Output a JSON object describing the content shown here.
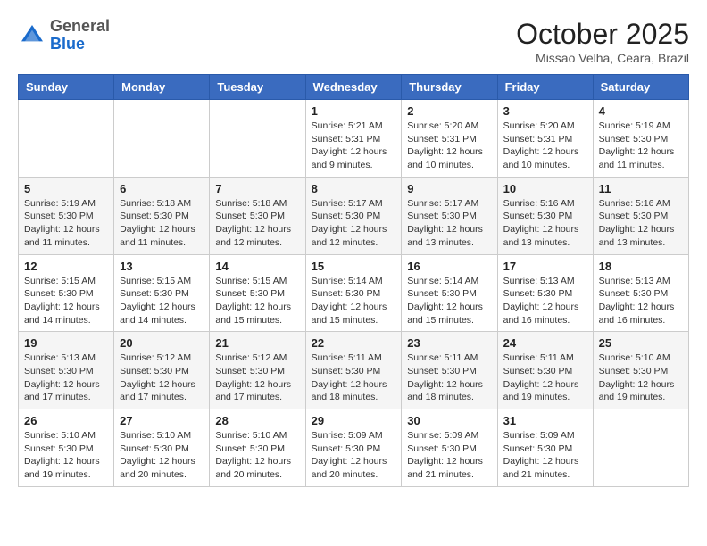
{
  "header": {
    "logo_general": "General",
    "logo_blue": "Blue",
    "month": "October 2025",
    "location": "Missao Velha, Ceara, Brazil"
  },
  "days_of_week": [
    "Sunday",
    "Monday",
    "Tuesday",
    "Wednesday",
    "Thursday",
    "Friday",
    "Saturday"
  ],
  "weeks": [
    [
      {
        "day": "",
        "info": ""
      },
      {
        "day": "",
        "info": ""
      },
      {
        "day": "",
        "info": ""
      },
      {
        "day": "1",
        "info": "Sunrise: 5:21 AM\nSunset: 5:31 PM\nDaylight: 12 hours\nand 9 minutes."
      },
      {
        "day": "2",
        "info": "Sunrise: 5:20 AM\nSunset: 5:31 PM\nDaylight: 12 hours\nand 10 minutes."
      },
      {
        "day": "3",
        "info": "Sunrise: 5:20 AM\nSunset: 5:31 PM\nDaylight: 12 hours\nand 10 minutes."
      },
      {
        "day": "4",
        "info": "Sunrise: 5:19 AM\nSunset: 5:30 PM\nDaylight: 12 hours\nand 11 minutes."
      }
    ],
    [
      {
        "day": "5",
        "info": "Sunrise: 5:19 AM\nSunset: 5:30 PM\nDaylight: 12 hours\nand 11 minutes."
      },
      {
        "day": "6",
        "info": "Sunrise: 5:18 AM\nSunset: 5:30 PM\nDaylight: 12 hours\nand 11 minutes."
      },
      {
        "day": "7",
        "info": "Sunrise: 5:18 AM\nSunset: 5:30 PM\nDaylight: 12 hours\nand 12 minutes."
      },
      {
        "day": "8",
        "info": "Sunrise: 5:17 AM\nSunset: 5:30 PM\nDaylight: 12 hours\nand 12 minutes."
      },
      {
        "day": "9",
        "info": "Sunrise: 5:17 AM\nSunset: 5:30 PM\nDaylight: 12 hours\nand 13 minutes."
      },
      {
        "day": "10",
        "info": "Sunrise: 5:16 AM\nSunset: 5:30 PM\nDaylight: 12 hours\nand 13 minutes."
      },
      {
        "day": "11",
        "info": "Sunrise: 5:16 AM\nSunset: 5:30 PM\nDaylight: 12 hours\nand 13 minutes."
      }
    ],
    [
      {
        "day": "12",
        "info": "Sunrise: 5:15 AM\nSunset: 5:30 PM\nDaylight: 12 hours\nand 14 minutes."
      },
      {
        "day": "13",
        "info": "Sunrise: 5:15 AM\nSunset: 5:30 PM\nDaylight: 12 hours\nand 14 minutes."
      },
      {
        "day": "14",
        "info": "Sunrise: 5:15 AM\nSunset: 5:30 PM\nDaylight: 12 hours\nand 15 minutes."
      },
      {
        "day": "15",
        "info": "Sunrise: 5:14 AM\nSunset: 5:30 PM\nDaylight: 12 hours\nand 15 minutes."
      },
      {
        "day": "16",
        "info": "Sunrise: 5:14 AM\nSunset: 5:30 PM\nDaylight: 12 hours\nand 15 minutes."
      },
      {
        "day": "17",
        "info": "Sunrise: 5:13 AM\nSunset: 5:30 PM\nDaylight: 12 hours\nand 16 minutes."
      },
      {
        "day": "18",
        "info": "Sunrise: 5:13 AM\nSunset: 5:30 PM\nDaylight: 12 hours\nand 16 minutes."
      }
    ],
    [
      {
        "day": "19",
        "info": "Sunrise: 5:13 AM\nSunset: 5:30 PM\nDaylight: 12 hours\nand 17 minutes."
      },
      {
        "day": "20",
        "info": "Sunrise: 5:12 AM\nSunset: 5:30 PM\nDaylight: 12 hours\nand 17 minutes."
      },
      {
        "day": "21",
        "info": "Sunrise: 5:12 AM\nSunset: 5:30 PM\nDaylight: 12 hours\nand 17 minutes."
      },
      {
        "day": "22",
        "info": "Sunrise: 5:11 AM\nSunset: 5:30 PM\nDaylight: 12 hours\nand 18 minutes."
      },
      {
        "day": "23",
        "info": "Sunrise: 5:11 AM\nSunset: 5:30 PM\nDaylight: 12 hours\nand 18 minutes."
      },
      {
        "day": "24",
        "info": "Sunrise: 5:11 AM\nSunset: 5:30 PM\nDaylight: 12 hours\nand 19 minutes."
      },
      {
        "day": "25",
        "info": "Sunrise: 5:10 AM\nSunset: 5:30 PM\nDaylight: 12 hours\nand 19 minutes."
      }
    ],
    [
      {
        "day": "26",
        "info": "Sunrise: 5:10 AM\nSunset: 5:30 PM\nDaylight: 12 hours\nand 19 minutes."
      },
      {
        "day": "27",
        "info": "Sunrise: 5:10 AM\nSunset: 5:30 PM\nDaylight: 12 hours\nand 20 minutes."
      },
      {
        "day": "28",
        "info": "Sunrise: 5:10 AM\nSunset: 5:30 PM\nDaylight: 12 hours\nand 20 minutes."
      },
      {
        "day": "29",
        "info": "Sunrise: 5:09 AM\nSunset: 5:30 PM\nDaylight: 12 hours\nand 20 minutes."
      },
      {
        "day": "30",
        "info": "Sunrise: 5:09 AM\nSunset: 5:30 PM\nDaylight: 12 hours\nand 21 minutes."
      },
      {
        "day": "31",
        "info": "Sunrise: 5:09 AM\nSunset: 5:30 PM\nDaylight: 12 hours\nand 21 minutes."
      },
      {
        "day": "",
        "info": ""
      }
    ]
  ]
}
